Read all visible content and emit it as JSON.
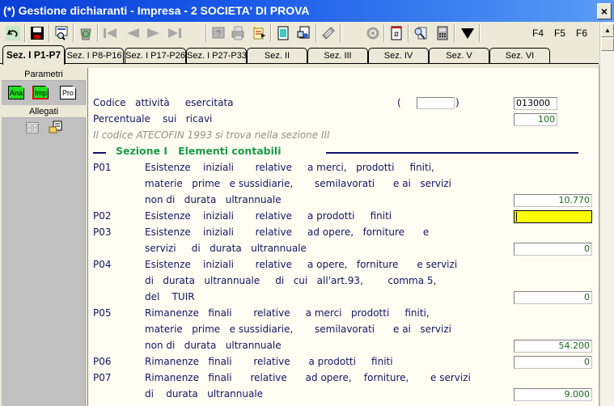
{
  "window": {
    "title": "(*) Gestione dichiaranti -  Impresa - 2 SOCIETA' DI PROVA",
    "close_label": "×"
  },
  "toolbar": {
    "buttons": [
      {
        "name": "undo",
        "icon": "undo-icon"
      },
      {
        "name": "save",
        "icon": "floppy-disk-icon"
      },
      {
        "name": "search",
        "icon": "search-screen-icon"
      },
      {
        "name": "recycle",
        "icon": "recycle-bin-icon"
      },
      {
        "name": "first",
        "icon": "first-record-icon"
      },
      {
        "name": "previous",
        "icon": "previous-record-icon"
      },
      {
        "name": "next",
        "icon": "next-record-icon"
      },
      {
        "name": "last",
        "icon": "last-record-icon"
      },
      {
        "name": "help",
        "icon": "help-icon"
      },
      {
        "name": "print",
        "icon": "printer-icon"
      },
      {
        "name": "edit-doc",
        "icon": "edit-document-icon"
      },
      {
        "name": "notepad",
        "icon": "notepad-icon"
      },
      {
        "name": "notes-user",
        "icon": "notes-user-icon"
      },
      {
        "name": "keyboard",
        "icon": "keyboard-icon"
      },
      {
        "name": "refresh",
        "icon": "refresh-icon"
      },
      {
        "name": "hash-doc",
        "icon": "hash-document-icon"
      },
      {
        "name": "zoom-doc",
        "icon": "magnify-document-icon"
      },
      {
        "name": "calculator",
        "icon": "calculator-icon"
      },
      {
        "name": "dropdown",
        "icon": "triangle-down-icon"
      }
    ],
    "fkeys": [
      "F4",
      "F5",
      "F6"
    ]
  },
  "tabs": [
    {
      "label": "Sez. I P1-P7",
      "active": true
    },
    {
      "label": "Sez. I P8-P16",
      "active": false
    },
    {
      "label": "Sez. I P17-P26",
      "active": false
    },
    {
      "label": "Sez. I P27-P33",
      "active": false
    },
    {
      "label": "Sez. II",
      "active": false
    },
    {
      "label": "Sez. III",
      "active": false
    },
    {
      "label": "Sez. IV",
      "active": false
    },
    {
      "label": "Sez. V",
      "active": false
    },
    {
      "label": "Sez. VI",
      "active": false
    }
  ],
  "sidebar": {
    "parametri_label": "Parametri",
    "parametri_items": [
      {
        "label": "Ana",
        "color": "#22dd22"
      },
      {
        "label": "Imp",
        "color": "#22dd22"
      },
      {
        "label": "Pro",
        "color": "#ffffff"
      }
    ],
    "allegati_label": "Allegati",
    "allegati_items": [
      {
        "icon": "form-icon"
      },
      {
        "icon": "folder-document-icon"
      }
    ]
  },
  "content": {
    "codice_label": "Codice   attività     esercitata",
    "codice_paren_open": "(",
    "codice_paren_close": ")",
    "codice_paren_value": "",
    "codice_value": "013000",
    "percentuale_label": "Percentuale    sui   ricavi",
    "percentuale_value": "100",
    "note": "Il codice ATECOFIN 1993 si trova nella sezione III",
    "section_title": "Sezione I   Elementi contabili",
    "rows": [
      {
        "code": "P01",
        "lines": [
          "Esistenze    iniziali       relative     a merci,   prodotti     finiti,",
          "materie   prime   e sussidiarie,       semilavorati      e ai   servizi",
          "non di   durata   ultrannuale"
        ],
        "value": "10.770",
        "active": false
      },
      {
        "code": "P02",
        "lines": [
          "Esistenze    iniziali       relative     a prodotti     finiti"
        ],
        "value": "",
        "active": true
      },
      {
        "code": "P03",
        "lines": [
          "Esistenze    iniziali       relative     ad opere,   forniture      e",
          "servizi     di   durata   ultrannuale"
        ],
        "value": "0",
        "active": false
      },
      {
        "code": "P04",
        "lines": [
          "Esistenze    iniziali       relative     a opere,   forniture      e servizi",
          "di   durata   ultrannuale     di   cui   all'art.93,        comma 5,",
          "del    TUIR"
        ],
        "value": "0",
        "active": false
      },
      {
        "code": "P05",
        "lines": [
          "Rimanenze   finali       relative     a merci   prodotti     finiti,",
          "materie   prime   e sussidiarie,       semilavorati      e ai   servizi",
          "non di   durata   ultrannuale"
        ],
        "value": "54.200",
        "active": false
      },
      {
        "code": "P06",
        "lines": [
          "Rimanenze   finali       relative      a prodotti     finiti"
        ],
        "value": "0",
        "active": false
      },
      {
        "code": "P07",
        "lines": [
          "Rimanenze   finali      relative      ad opere,    forniture,       e servizi",
          "di    durata   ultrannuale"
        ],
        "value": "9.000",
        "active": false
      }
    ]
  }
}
